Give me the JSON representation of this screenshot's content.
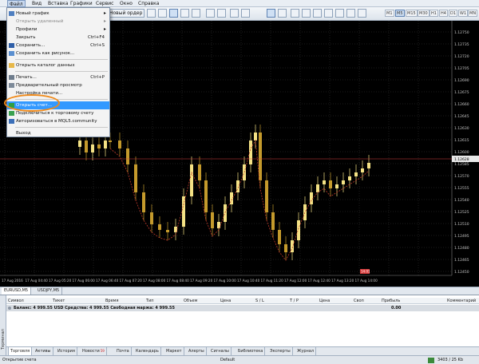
{
  "menubar": [
    "Файл",
    "Вид",
    "Вставка",
    "Графики",
    "Сервис",
    "Окно",
    "Справка"
  ],
  "toolbar": {
    "new_order": "Новый ордер",
    "timeframes": [
      "M1",
      "M5",
      "M15",
      "M30",
      "H1",
      "H4",
      "D1",
      "W1",
      "MN"
    ],
    "active_timeframe": "M5"
  },
  "file_menu": {
    "items": [
      {
        "label": "Новый график",
        "shortcut": "",
        "arrow": "▸",
        "disabled": false
      },
      {
        "label": "Открыть удаленный",
        "shortcut": "",
        "arrow": "▸",
        "disabled": true
      },
      {
        "label": "Профили",
        "shortcut": "",
        "arrow": "▸",
        "disabled": false
      },
      {
        "label": "Закрыть",
        "shortcut": "Ctrl+F4",
        "arrow": "",
        "disabled": false
      },
      {
        "label": "Сохранить...",
        "shortcut": "Ctrl+S",
        "arrow": "",
        "disabled": false
      },
      {
        "label": "Сохранить как рисунок...",
        "shortcut": "",
        "arrow": "",
        "disabled": false
      },
      {
        "label": "Открыть каталог данных",
        "shortcut": "",
        "arrow": "",
        "disabled": false
      },
      {
        "label": "Печать...",
        "shortcut": "Ctrl+P",
        "arrow": "",
        "disabled": false
      },
      {
        "label": "Предварительный просмотр",
        "shortcut": "",
        "arrow": "",
        "disabled": false
      },
      {
        "label": "Настройка печати...",
        "shortcut": "",
        "arrow": "",
        "disabled": false
      },
      {
        "label": "Открыть счет...",
        "shortcut": "",
        "arrow": "",
        "disabled": false,
        "highlighted": true
      },
      {
        "label": "Подключиться к торговому счету",
        "shortcut": "",
        "arrow": "",
        "disabled": false
      },
      {
        "label": "Авторизоваться в MQL5.community",
        "shortcut": "",
        "arrow": "",
        "disabled": false
      },
      {
        "label": "Выход",
        "shortcut": "",
        "arrow": "",
        "disabled": false
      }
    ]
  },
  "chart": {
    "price_labels": [
      "1.12750",
      "1.12735",
      "1.12720",
      "1.12705",
      "1.12690",
      "1.12675",
      "1.12660",
      "1.12645",
      "1.12630",
      "1.12615",
      "1.12600",
      "1.12585",
      "1.12570",
      "1.12555",
      "1.12540",
      "1.12525",
      "1.12510",
      "1.12495",
      "1.12480",
      "1.12465",
      "1.12450"
    ],
    "current_price": "1.12628",
    "time_labels": [
      "17 Aug 2016",
      "17 Aug 04:40",
      "17 Aug 05:20",
      "17 Aug 06:00",
      "17 Aug 06:40",
      "17 Aug 07:20",
      "17 Aug 08:00",
      "17 Aug 08:40",
      "17 Aug 09:20",
      "17 Aug 10:00",
      "17 Aug 10:40",
      "17 Aug 11:20",
      "17 Aug 12:00",
      "17 Aug 12:40",
      "17 Aug 13:20",
      "17 Aug 14:00"
    ],
    "colors": {
      "bull": "#f4e285",
      "bear": "#c49a2c",
      "ma": "#c0392b",
      "current_line": "#d94040",
      "grid": "#3a3a3a"
    },
    "badge": "14:01"
  },
  "chart_tabs": [
    "EURUSD,M5",
    "USDJPY,M5"
  ],
  "terminal": {
    "side_label": "Терминал",
    "headers": [
      "Символ",
      "Тикет",
      "Время",
      "Тип",
      "Объем",
      "Цена",
      "S / L",
      "T / P",
      "Цена",
      "Своп",
      "Прибыль",
      "Комментарий"
    ],
    "balance_text": "Баланс: 4 999.55 USD  Средства: 4 999.55  Свободная маржа: 4 999.55",
    "balance_value": "0.00",
    "tabs": [
      "Торговля",
      "Активы",
      "История",
      "Новости",
      "Почта",
      "Календарь",
      "Маркет",
      "Алерты",
      "Сигналы",
      "Библиотека",
      "Эксперты",
      "Журнал"
    ],
    "news_badge": "59"
  },
  "status": {
    "left": "Открытие счета",
    "middle": "Default",
    "right": "3403 / 25 Kb"
  }
}
